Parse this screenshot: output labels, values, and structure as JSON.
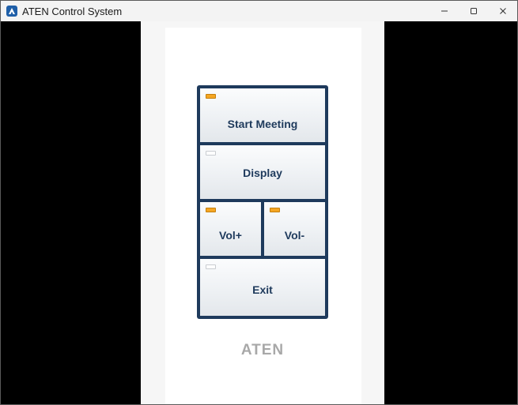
{
  "window": {
    "title": "ATEN Control System",
    "controls": {
      "minimize": "−",
      "maximize": "□",
      "close": "×"
    }
  },
  "keypad": {
    "buttons": [
      {
        "label": "Start Meeting",
        "led": "on"
      },
      {
        "label": "Display",
        "led": "off"
      },
      {
        "label": "Vol+",
        "led": "on"
      },
      {
        "label": "Vol-",
        "led": "on"
      },
      {
        "label": "Exit",
        "led": "off"
      }
    ]
  },
  "brand": {
    "logo_text": "ATEN"
  },
  "colors": {
    "frame": "#1e3a5c",
    "led_on": "#f5a623",
    "led_off": "#ffffff",
    "logo": "#a8a8a8"
  }
}
